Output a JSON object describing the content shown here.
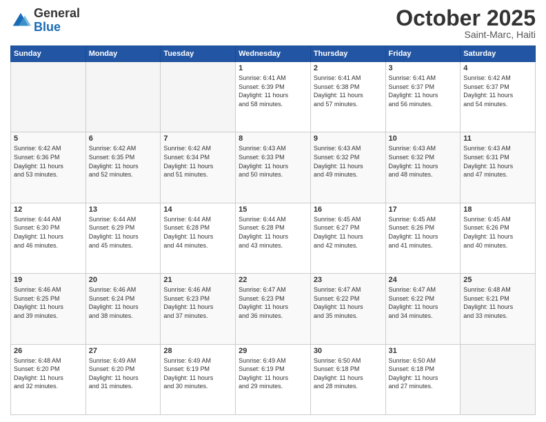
{
  "header": {
    "logo_general": "General",
    "logo_blue": "Blue",
    "month": "October 2025",
    "location": "Saint-Marc, Haiti"
  },
  "days_of_week": [
    "Sunday",
    "Monday",
    "Tuesday",
    "Wednesday",
    "Thursday",
    "Friday",
    "Saturday"
  ],
  "weeks": [
    [
      {
        "day": "",
        "content": ""
      },
      {
        "day": "",
        "content": ""
      },
      {
        "day": "",
        "content": ""
      },
      {
        "day": "1",
        "content": "Sunrise: 6:41 AM\nSunset: 6:39 PM\nDaylight: 11 hours\nand 58 minutes."
      },
      {
        "day": "2",
        "content": "Sunrise: 6:41 AM\nSunset: 6:38 PM\nDaylight: 11 hours\nand 57 minutes."
      },
      {
        "day": "3",
        "content": "Sunrise: 6:41 AM\nSunset: 6:37 PM\nDaylight: 11 hours\nand 56 minutes."
      },
      {
        "day": "4",
        "content": "Sunrise: 6:42 AM\nSunset: 6:37 PM\nDaylight: 11 hours\nand 54 minutes."
      }
    ],
    [
      {
        "day": "5",
        "content": "Sunrise: 6:42 AM\nSunset: 6:36 PM\nDaylight: 11 hours\nand 53 minutes."
      },
      {
        "day": "6",
        "content": "Sunrise: 6:42 AM\nSunset: 6:35 PM\nDaylight: 11 hours\nand 52 minutes."
      },
      {
        "day": "7",
        "content": "Sunrise: 6:42 AM\nSunset: 6:34 PM\nDaylight: 11 hours\nand 51 minutes."
      },
      {
        "day": "8",
        "content": "Sunrise: 6:43 AM\nSunset: 6:33 PM\nDaylight: 11 hours\nand 50 minutes."
      },
      {
        "day": "9",
        "content": "Sunrise: 6:43 AM\nSunset: 6:32 PM\nDaylight: 11 hours\nand 49 minutes."
      },
      {
        "day": "10",
        "content": "Sunrise: 6:43 AM\nSunset: 6:32 PM\nDaylight: 11 hours\nand 48 minutes."
      },
      {
        "day": "11",
        "content": "Sunrise: 6:43 AM\nSunset: 6:31 PM\nDaylight: 11 hours\nand 47 minutes."
      }
    ],
    [
      {
        "day": "12",
        "content": "Sunrise: 6:44 AM\nSunset: 6:30 PM\nDaylight: 11 hours\nand 46 minutes."
      },
      {
        "day": "13",
        "content": "Sunrise: 6:44 AM\nSunset: 6:29 PM\nDaylight: 11 hours\nand 45 minutes."
      },
      {
        "day": "14",
        "content": "Sunrise: 6:44 AM\nSunset: 6:28 PM\nDaylight: 11 hours\nand 44 minutes."
      },
      {
        "day": "15",
        "content": "Sunrise: 6:44 AM\nSunset: 6:28 PM\nDaylight: 11 hours\nand 43 minutes."
      },
      {
        "day": "16",
        "content": "Sunrise: 6:45 AM\nSunset: 6:27 PM\nDaylight: 11 hours\nand 42 minutes."
      },
      {
        "day": "17",
        "content": "Sunrise: 6:45 AM\nSunset: 6:26 PM\nDaylight: 11 hours\nand 41 minutes."
      },
      {
        "day": "18",
        "content": "Sunrise: 6:45 AM\nSunset: 6:26 PM\nDaylight: 11 hours\nand 40 minutes."
      }
    ],
    [
      {
        "day": "19",
        "content": "Sunrise: 6:46 AM\nSunset: 6:25 PM\nDaylight: 11 hours\nand 39 minutes."
      },
      {
        "day": "20",
        "content": "Sunrise: 6:46 AM\nSunset: 6:24 PM\nDaylight: 11 hours\nand 38 minutes."
      },
      {
        "day": "21",
        "content": "Sunrise: 6:46 AM\nSunset: 6:23 PM\nDaylight: 11 hours\nand 37 minutes."
      },
      {
        "day": "22",
        "content": "Sunrise: 6:47 AM\nSunset: 6:23 PM\nDaylight: 11 hours\nand 36 minutes."
      },
      {
        "day": "23",
        "content": "Sunrise: 6:47 AM\nSunset: 6:22 PM\nDaylight: 11 hours\nand 35 minutes."
      },
      {
        "day": "24",
        "content": "Sunrise: 6:47 AM\nSunset: 6:22 PM\nDaylight: 11 hours\nand 34 minutes."
      },
      {
        "day": "25",
        "content": "Sunrise: 6:48 AM\nSunset: 6:21 PM\nDaylight: 11 hours\nand 33 minutes."
      }
    ],
    [
      {
        "day": "26",
        "content": "Sunrise: 6:48 AM\nSunset: 6:20 PM\nDaylight: 11 hours\nand 32 minutes."
      },
      {
        "day": "27",
        "content": "Sunrise: 6:49 AM\nSunset: 6:20 PM\nDaylight: 11 hours\nand 31 minutes."
      },
      {
        "day": "28",
        "content": "Sunrise: 6:49 AM\nSunset: 6:19 PM\nDaylight: 11 hours\nand 30 minutes."
      },
      {
        "day": "29",
        "content": "Sunrise: 6:49 AM\nSunset: 6:19 PM\nDaylight: 11 hours\nand 29 minutes."
      },
      {
        "day": "30",
        "content": "Sunrise: 6:50 AM\nSunset: 6:18 PM\nDaylight: 11 hours\nand 28 minutes."
      },
      {
        "day": "31",
        "content": "Sunrise: 6:50 AM\nSunset: 6:18 PM\nDaylight: 11 hours\nand 27 minutes."
      },
      {
        "day": "",
        "content": ""
      }
    ]
  ]
}
